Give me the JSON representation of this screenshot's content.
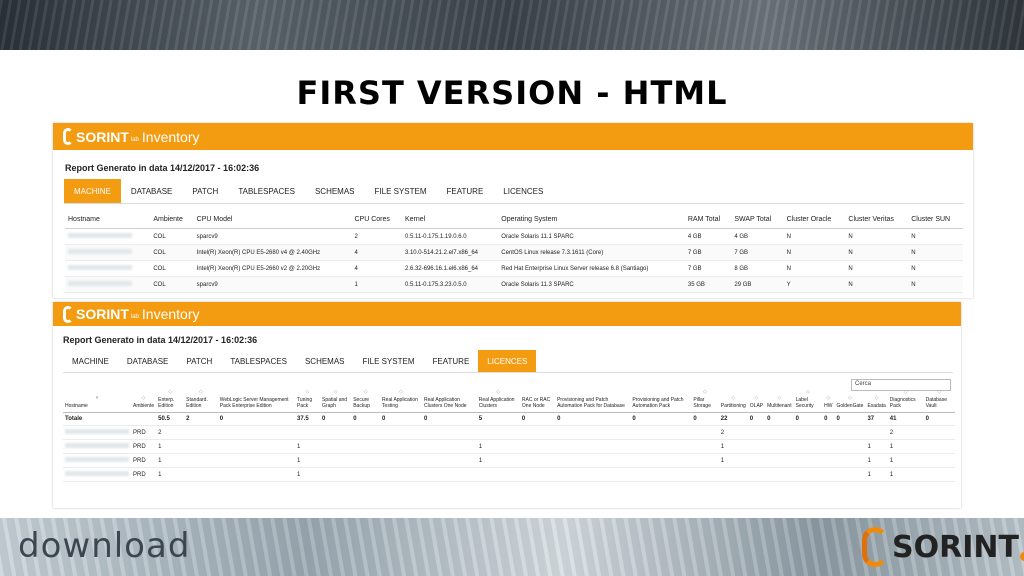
{
  "slide": {
    "title": "FIRST VERSION - HTML",
    "download_text": "download",
    "sorint_logo_word": "SORINT",
    "sorint_logo_sub": "lab"
  },
  "app": {
    "logo_word": "SORINT",
    "logo_sub": "lab",
    "logo_product": "Inventory",
    "report_line": "Report Generato in data 14/12/2017 - 16:02:36",
    "accent_color": "#f39c12",
    "tabs": [
      "MACHINE",
      "DATABASE",
      "PATCH",
      "TABLESPACES",
      "SCHEMAS",
      "FILE SYSTEM",
      "FEATURE",
      "LICENCES"
    ]
  },
  "machine_view": {
    "active_tab": "MACHINE",
    "columns": [
      "Hostname",
      "Ambiente",
      "CPU Model",
      "CPU Cores",
      "Kernel",
      "Operating System",
      "RAM Total",
      "SWAP Total",
      "Cluster Oracle",
      "Cluster Veritas",
      "Cluster SUN"
    ],
    "rows": [
      [
        "COL",
        "sparcv9",
        "2",
        "0.5.11-0.175.1.19.0.6.0",
        "Oracle Solaris 11.1 SPARC",
        "4 GB",
        "4 GB",
        "N",
        "N",
        "N"
      ],
      [
        "COL",
        "Intel(R) Xeon(R) CPU E5-2680 v4 @ 2.40GHz",
        "4",
        "3.10.0-514.21.2.el7.x86_64",
        "CentOS Linux release 7.3.1611 (Core)",
        "7 GB",
        "7 GB",
        "N",
        "N",
        "N"
      ],
      [
        "COL",
        "Intel(R) Xeon(R) CPU E5-2660 v2 @ 2.20GHz",
        "4",
        "2.6.32-696.16.1.el6.x86_64",
        "Red Hat Enterprise Linux Server release 6.8 (Santiago)",
        "7 GB",
        "8 GB",
        "N",
        "N",
        "N"
      ],
      [
        "COL",
        "sparcv9",
        "1",
        "0.5.11-0.175.3.23.0.5.0",
        "Oracle Solaris 11.3 SPARC",
        "35 GB",
        "29 GB",
        "Y",
        "N",
        "N"
      ]
    ]
  },
  "licences_view": {
    "active_tab": "LICENCES",
    "search_value": "Cerca",
    "columns": [
      "Hostname",
      "Ambiente",
      "Enterp. Edition",
      "Standard. Edition",
      "WebLogic Server Management Pack Enterprise Edition",
      "Tuning Pack",
      "Spatial and Graph",
      "Secure Backup",
      "Real Application Testing",
      "Real Application Clusters One Node",
      "Real Application Clusters",
      "RAC or RAC One Node",
      "Provisioning and Patch Automation Pack for Database",
      "Provisioning and Patch Automation Pack",
      "Pillar Storage",
      "Partitioning",
      "OLAP",
      "Multitenant",
      "Label Security",
      "HW",
      "GoldenGate",
      "Exadata",
      "Diagnostics Pack",
      "Database Vault"
    ],
    "total_row": [
      "Totale",
      "",
      "50.5",
      "2",
      "0",
      "37.5",
      "0",
      "0",
      "0",
      "0",
      "5",
      "0",
      "0",
      "0",
      "0",
      "22",
      "0",
      "0",
      "0",
      "0",
      "0",
      "37",
      "41",
      "0"
    ],
    "rows": [
      [
        "",
        "PRD",
        "2",
        "",
        "",
        "",
        "",
        "",
        "",
        "",
        "",
        "",
        "",
        "",
        "",
        "2",
        "",
        "",
        "",
        "",
        "",
        "",
        "2",
        ""
      ],
      [
        "",
        "PRD",
        "1",
        "",
        "",
        "1",
        "",
        "",
        "",
        "",
        "1",
        "",
        "",
        "",
        "",
        "1",
        "",
        "",
        "",
        "",
        "",
        "1",
        "1",
        ""
      ],
      [
        "",
        "PRD",
        "1",
        "",
        "",
        "1",
        "",
        "",
        "",
        "",
        "1",
        "",
        "",
        "",
        "",
        "1",
        "",
        "",
        "",
        "",
        "",
        "1",
        "1",
        ""
      ],
      [
        "",
        "PRD",
        "1",
        "",
        "",
        "1",
        "",
        "",
        "",
        "",
        "",
        "",
        "",
        "",
        "",
        "",
        "",
        "",
        "",
        "",
        "",
        "1",
        "1",
        ""
      ]
    ]
  }
}
